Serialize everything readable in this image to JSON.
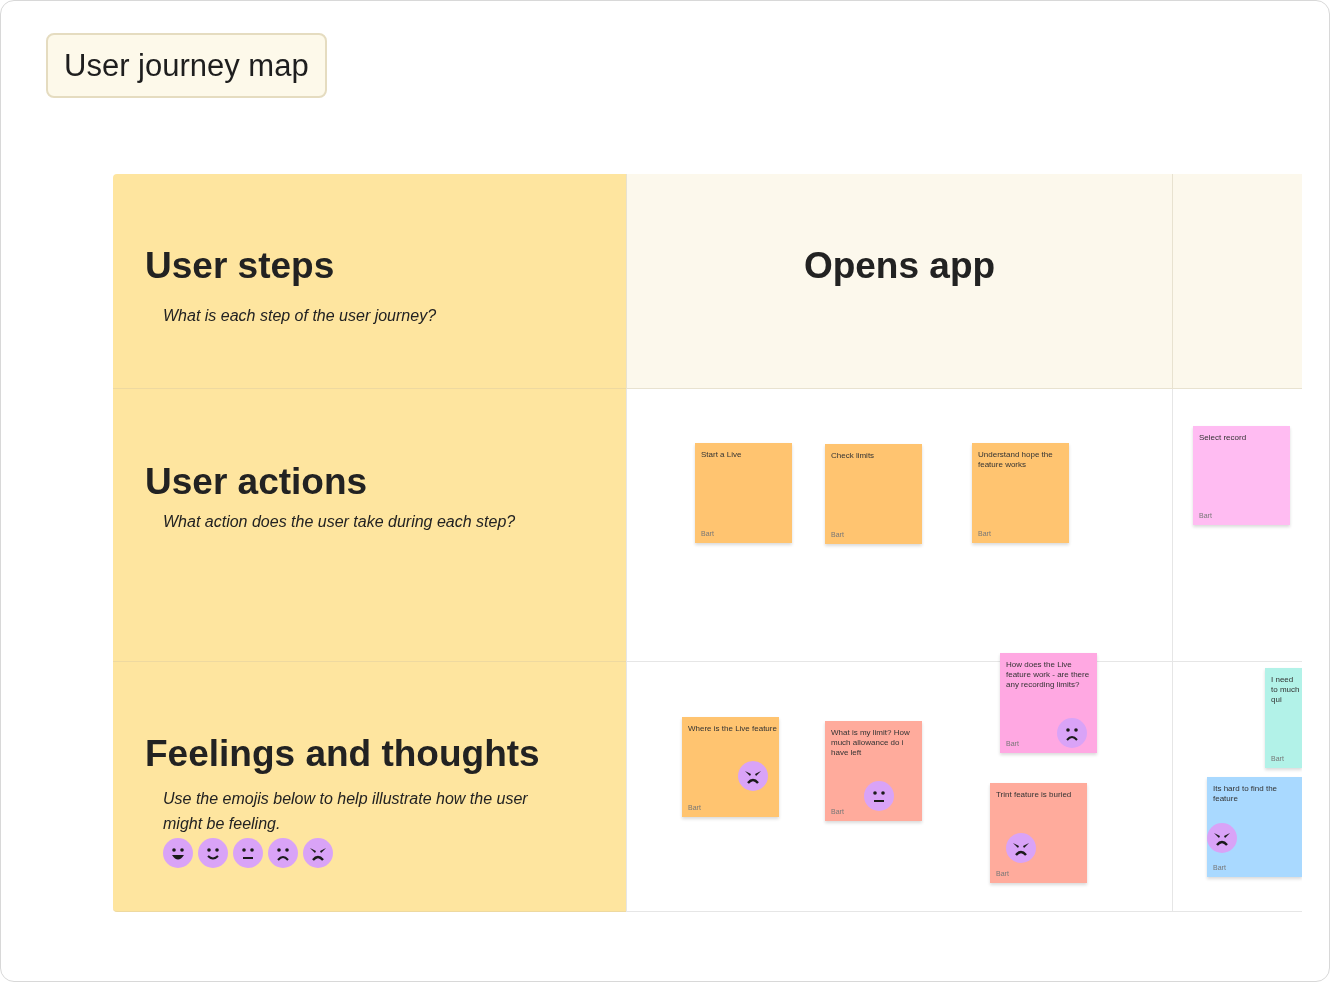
{
  "board": {
    "title": "User journey map"
  },
  "rows": [
    {
      "title": "User steps",
      "subtitle": "What is each step of the user journey?"
    },
    {
      "title": "User actions",
      "subtitle": "What action does the user take during each step?"
    },
    {
      "title": "Feelings and thoughts",
      "subtitle": "Use the emojis below to help illustrate how the user might be feeling.",
      "emojis": [
        {
          "kind": "grinning"
        },
        {
          "kind": "smiling"
        },
        {
          "kind": "neutral"
        },
        {
          "kind": "frowning"
        },
        {
          "kind": "angry"
        }
      ]
    }
  ],
  "columns": [
    {
      "title": "Opens app"
    },
    {}
  ],
  "notes": [
    {
      "text": "Start a Live",
      "author": "Bart",
      "color": "#ffc470"
    },
    {
      "text": "Check limits",
      "author": "Bart",
      "color": "#ffc470"
    },
    {
      "text": "Understand hope the feature works",
      "author": "Bart",
      "color": "#ffc470"
    },
    {
      "text": "Select record",
      "author": "Bart",
      "color": "#ffbcf2"
    },
    {
      "text": "Where is the Live feature",
      "author": "Bart",
      "color": "#ffc470",
      "emoji": {
        "kind": "angry"
      }
    },
    {
      "text": "What is my limit? How much allowance do i have left",
      "author": "Bart",
      "color": "#ffab9c",
      "emoji": {
        "kind": "neutral"
      }
    },
    {
      "text": "How does the Live feature work - are there any recording limits?",
      "author": "Bart",
      "color": "#ffa8e2",
      "emoji": {
        "kind": "frowning"
      }
    },
    {
      "text": "Trint feature is buried",
      "author": "Bart",
      "color": "#ffab9c",
      "emoji": {
        "kind": "angry"
      }
    },
    {
      "text": "I need to much qui",
      "author": "Bart",
      "color": "#b2f2e8"
    },
    {
      "text": "Its hard to find the feature",
      "author": "Bart",
      "color": "#a9d9ff",
      "emoji": {
        "kind": "angry"
      }
    }
  ]
}
